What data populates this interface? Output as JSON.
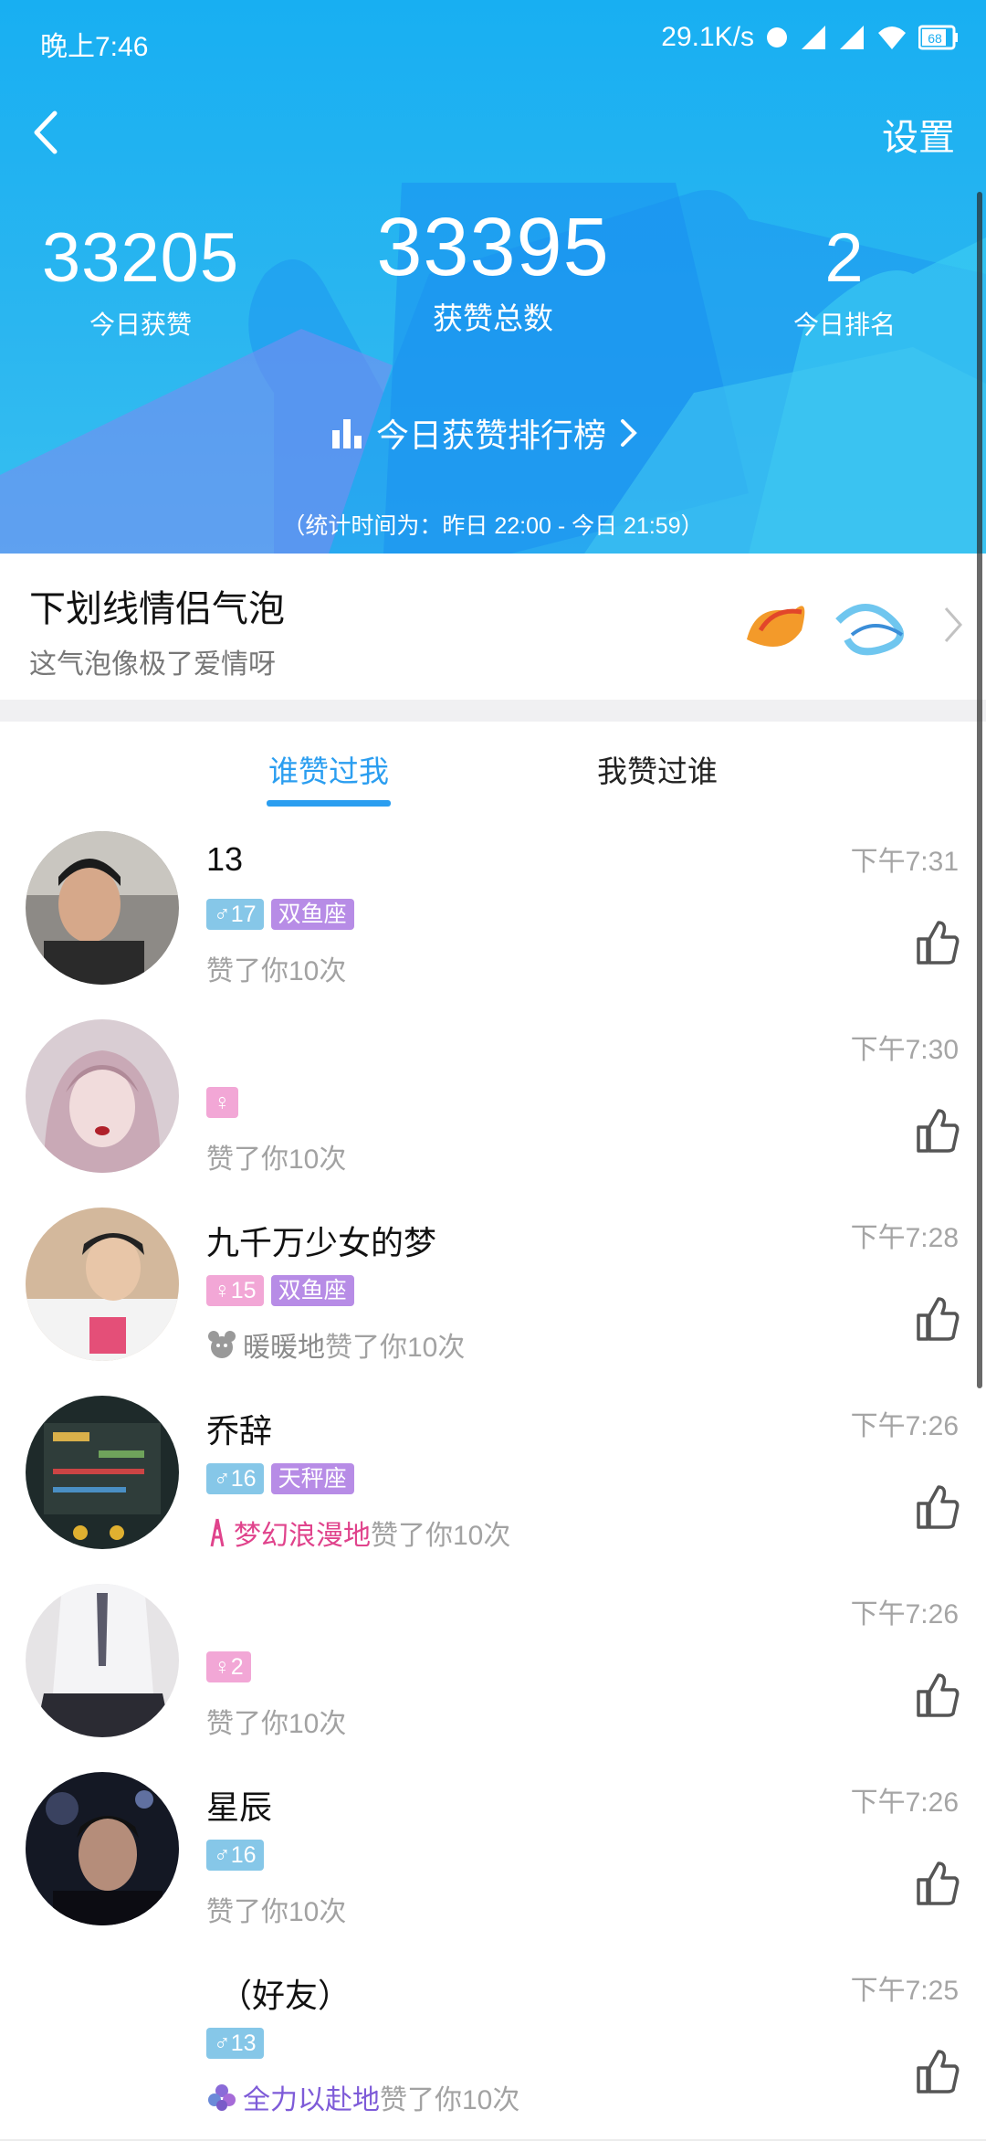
{
  "status_bar": {
    "time": "晚上7:46",
    "net_speed": "29.1K/s",
    "battery": "68"
  },
  "nav": {
    "back_icon": "chevron-left-icon",
    "settings_label": "设置"
  },
  "stats": {
    "today_likes": {
      "value": "33205",
      "label": "今日获赞"
    },
    "total_likes": {
      "value": "33395",
      "label": "获赞总数"
    },
    "today_rank": {
      "value": "2",
      "label": "今日排名"
    }
  },
  "rank_link": {
    "label": "今日获赞排行榜",
    "icon": "bar-chart-icon"
  },
  "stat_period": "（统计时间为：昨日 22:00 - 今日 21:59）",
  "bubble_banner": {
    "title": "下划线情侣气泡",
    "subtitle": "这气泡像极了爱情呀"
  },
  "tabs": [
    {
      "label": "谁赞过我",
      "active": true
    },
    {
      "label": "我赞过谁",
      "active": false
    }
  ],
  "likes": [
    {
      "name": "13",
      "time": "下午7:31",
      "gender": "♂",
      "age": "17",
      "sign": "双鱼座",
      "like_prefix": "",
      "like_text": "赞了你10次"
    },
    {
      "name": "",
      "time": "下午7:30",
      "gender": "♀",
      "age": "",
      "sign": "",
      "like_prefix": "",
      "like_text": "赞了你10次"
    },
    {
      "name": "九千万少女的梦",
      "time": "下午7:28",
      "gender": "♀",
      "age": "15",
      "sign": "双鱼座",
      "like_prefix": "暖暖地",
      "like_text": "赞了你10次"
    },
    {
      "name": "乔辞",
      "time": "下午7:26",
      "gender": "♂",
      "age": "16",
      "sign": "天秤座",
      "like_prefix": "梦幻浪漫地",
      "like_text": "赞了你10次"
    },
    {
      "name": "",
      "time": "下午7:26",
      "gender": "♀",
      "age": "2",
      "sign": "",
      "like_prefix": "",
      "like_text": "赞了你10次"
    },
    {
      "name": "星辰",
      "time": "下午7:26",
      "gender": "♂",
      "age": "16",
      "sign": "",
      "like_prefix": "",
      "like_text": "赞了你10次"
    },
    {
      "name": "（好友）",
      "time": "下午7:25",
      "gender": "♂",
      "age": "13",
      "sign": "",
      "like_prefix": "全力以赴地",
      "like_text": "赞了你10次"
    }
  ],
  "colors": {
    "header": "#18aff2",
    "accent": "#2b9ef0",
    "male": "#86c7e8",
    "female": "#f2a7d6",
    "sign": "#b78ce6"
  }
}
